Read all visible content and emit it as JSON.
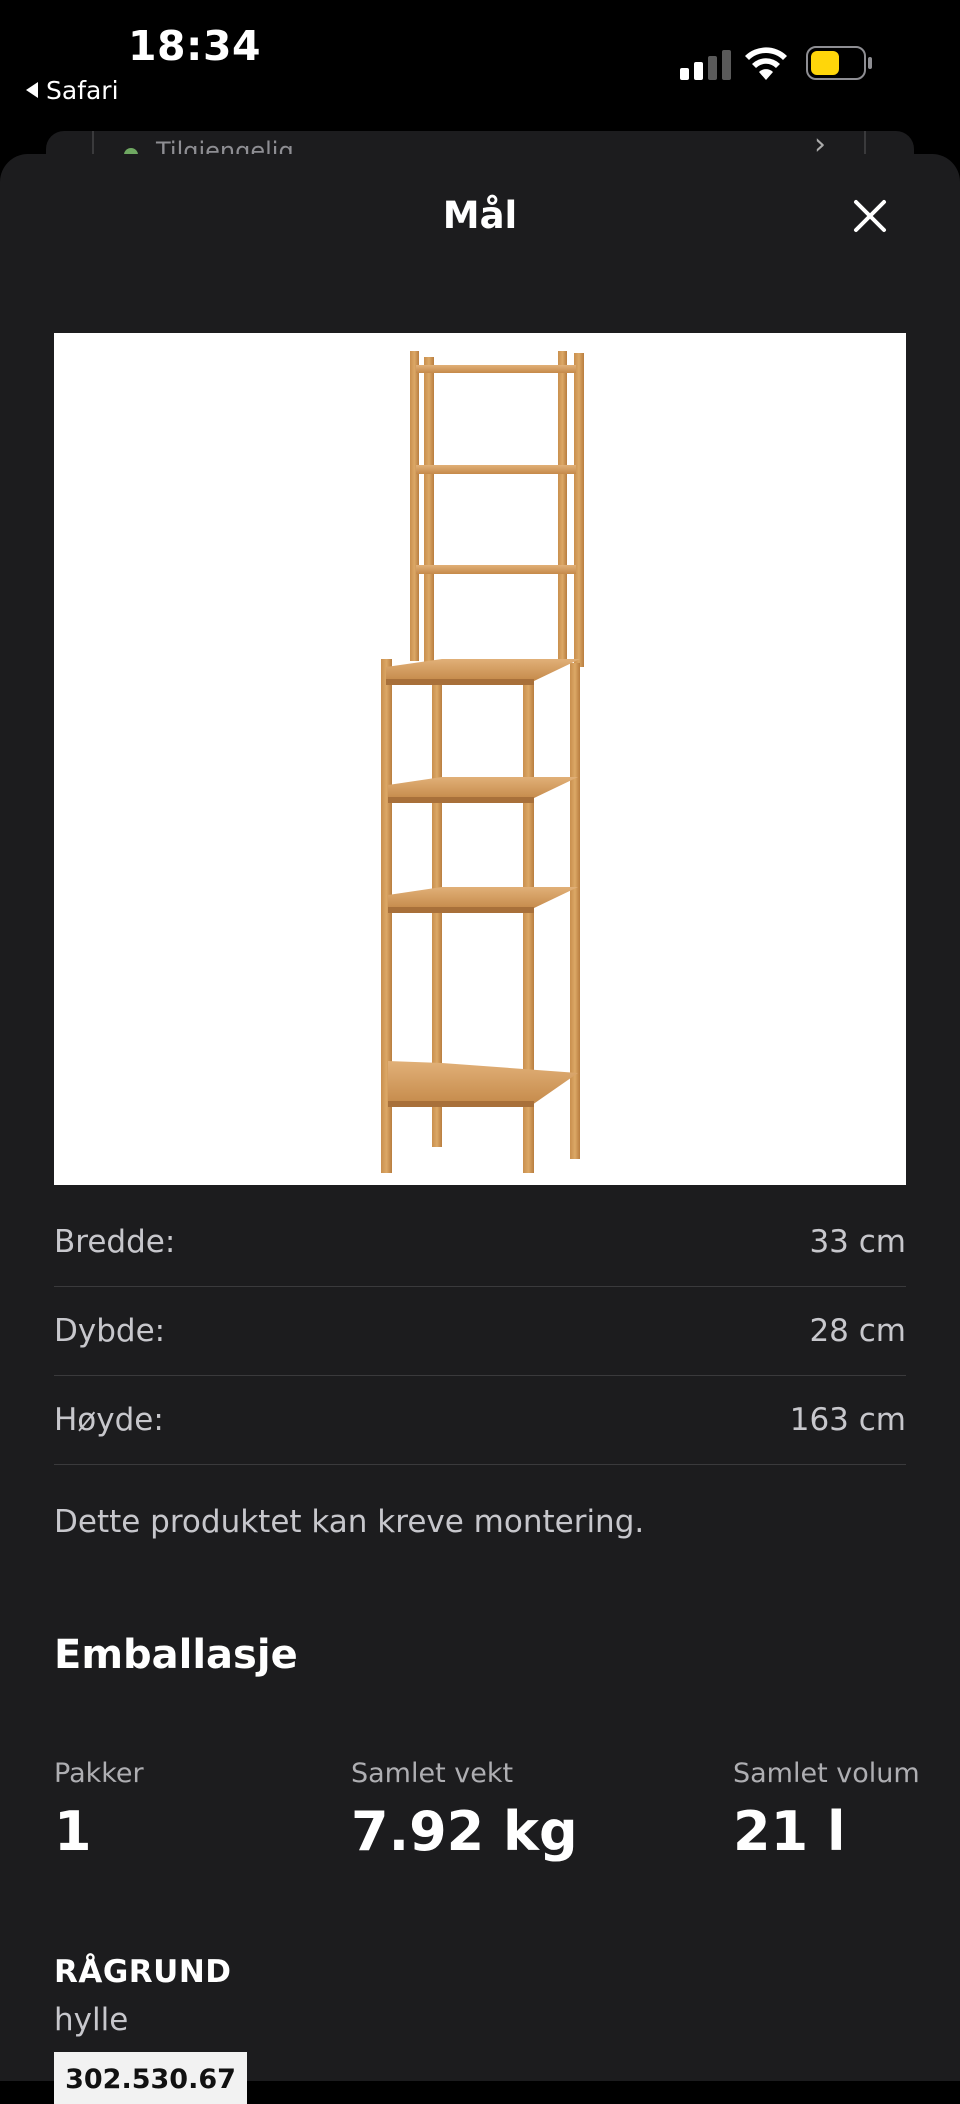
{
  "status_bar": {
    "time": "18:34",
    "back_label": "Safari",
    "battery_color": "#ffd60a"
  },
  "background_page": {
    "availability_text": "Tilgjengelig",
    "availability_color": "#6fa862"
  },
  "sheet": {
    "title": "Mål",
    "close_icon": "close-icon",
    "product_image_alt": "RÅGRUND hylle",
    "dimensions": [
      {
        "label": "Bredde:",
        "value": "33 cm"
      },
      {
        "label": "Dybde:",
        "value": "28 cm"
      },
      {
        "label": "Høyde:",
        "value": "163 cm"
      }
    ],
    "assembly_note": "Dette produktet kan kreve montering.",
    "packaging": {
      "title": "Emballasje",
      "stats": [
        {
          "label": "Pakker",
          "value": "1"
        },
        {
          "label": "Samlet vekt",
          "value": "7.92 kg"
        },
        {
          "label": "Samlet volum",
          "value": "21 l"
        }
      ]
    },
    "product": {
      "name": "RÅGRUND",
      "type": "hylle",
      "article_number": "302.530.67"
    }
  }
}
